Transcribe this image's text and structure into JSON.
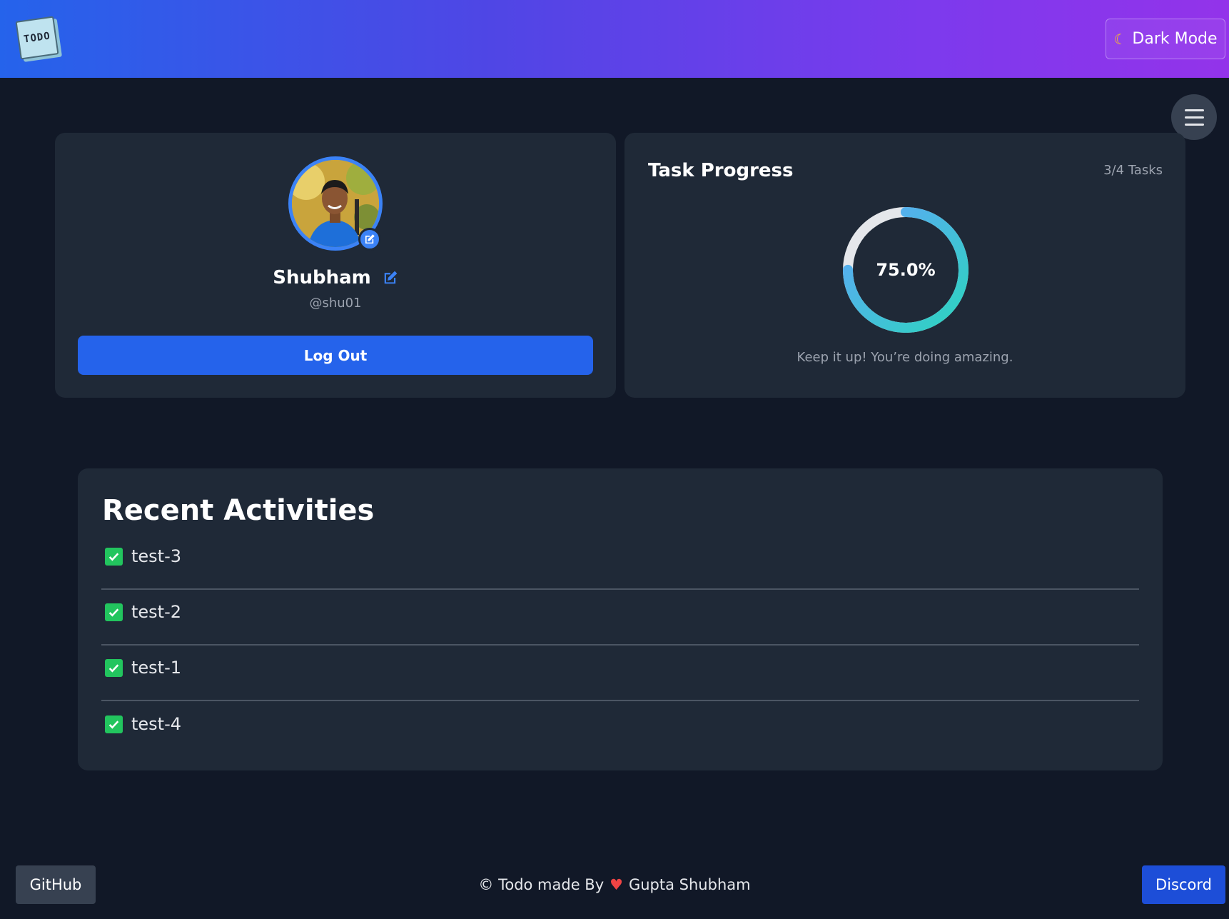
{
  "header": {
    "logo_text": "TODO",
    "dark_mode_icon": "moon-icon",
    "dark_mode_label": "Dark Mode",
    "menu_icon": "hamburger-icon"
  },
  "profile": {
    "name": "Shubham",
    "handle": "@shu01",
    "logout_label": "Log Out",
    "accent_color": "#3b82f6"
  },
  "progress": {
    "title": "Task Progress",
    "count_label": "3/4 Tasks",
    "percent_label": "75.0%",
    "fraction": 0.75,
    "message": "Keep it up! You’re doing amazing.",
    "gradient_start": "#60a5fa",
    "gradient_end": "#2dd4bf",
    "track_color": "#e5e7eb"
  },
  "activities": {
    "title": "Recent Activities",
    "items": [
      {
        "label": "test-3"
      },
      {
        "label": "test-2"
      },
      {
        "label": "test-1"
      },
      {
        "label": "test-4"
      }
    ]
  },
  "footer": {
    "github_label": "GitHub",
    "credit_prefix": "© Todo made By",
    "credit_name": "Gupta Shubham",
    "discord_label": "Discord"
  }
}
